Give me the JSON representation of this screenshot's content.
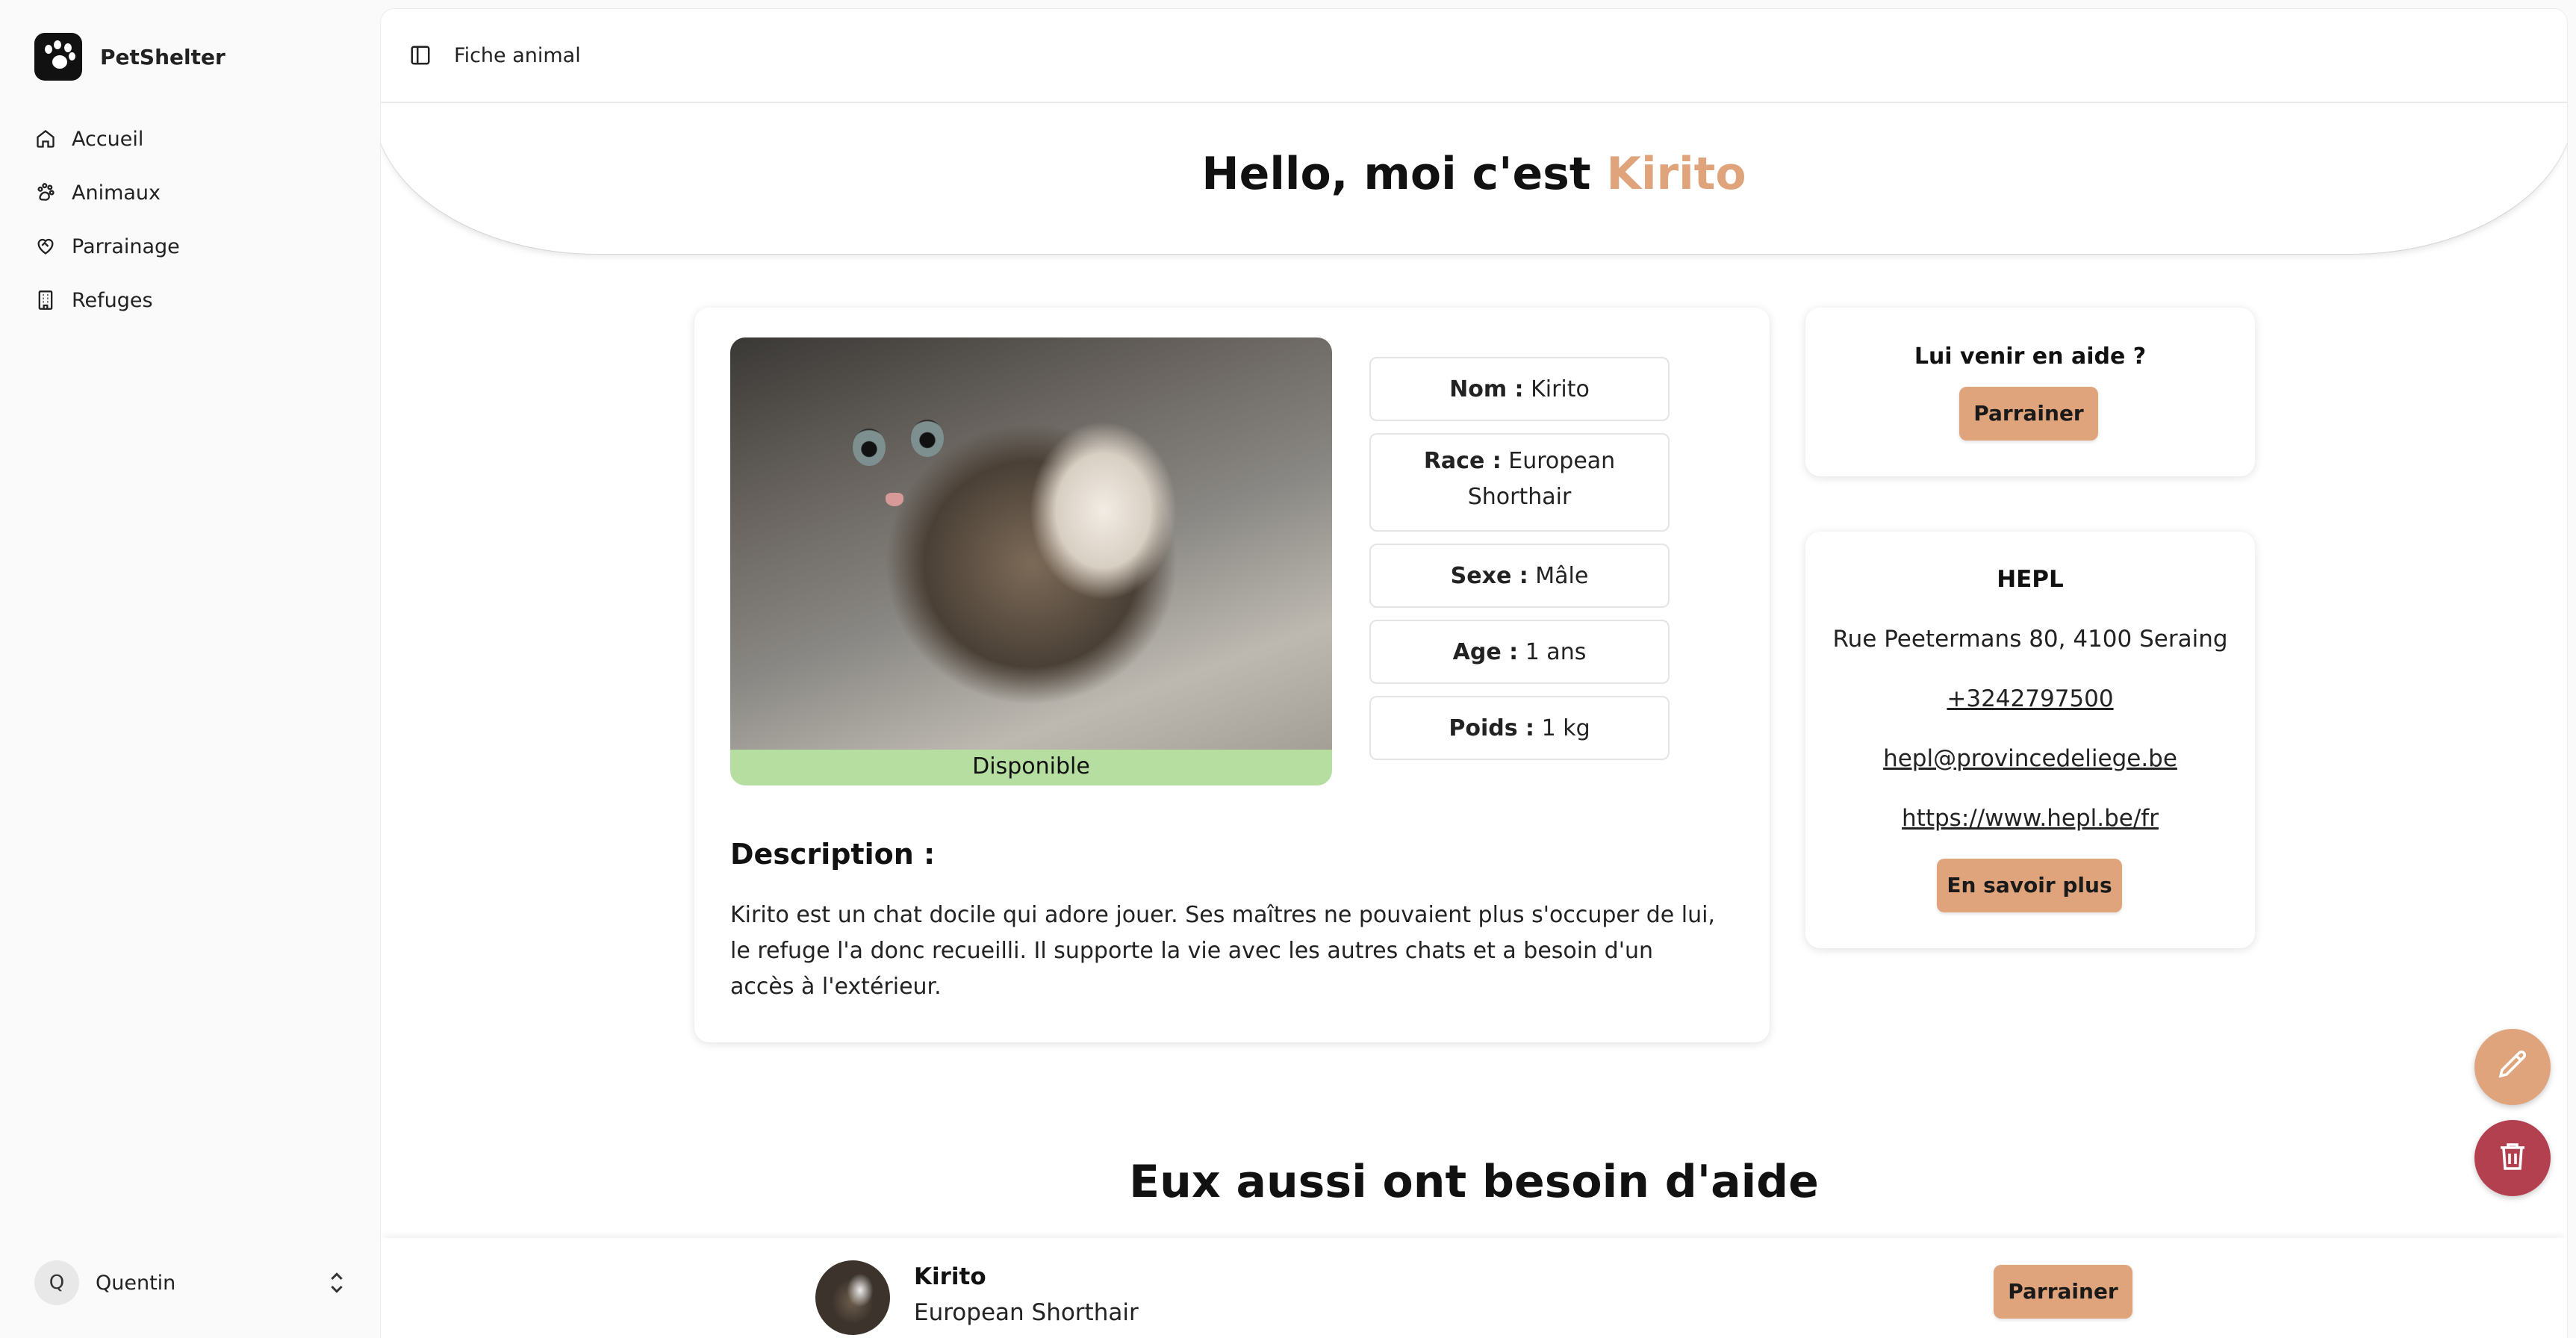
{
  "app": {
    "name": "PetShelter"
  },
  "sidebar": {
    "items": [
      {
        "label": "Accueil",
        "icon": "home-icon"
      },
      {
        "label": "Animaux",
        "icon": "paw-icon"
      },
      {
        "label": "Parrainage",
        "icon": "heart-handshake-icon"
      },
      {
        "label": "Refuges",
        "icon": "building-icon"
      }
    ],
    "user": {
      "initial": "Q",
      "name": "Quentin"
    }
  },
  "header": {
    "breadcrumb": "Fiche animal"
  },
  "hero": {
    "prefix": "Hello, moi c'est ",
    "name": "Kirito"
  },
  "animal": {
    "status": "Disponible",
    "status_color": "#b5dea0",
    "facts": [
      {
        "key": "Nom :",
        "value": "Kirito"
      },
      {
        "key": "Race :",
        "value": "European Shorthair"
      },
      {
        "key": "Sexe :",
        "value": "Mâle"
      },
      {
        "key": "Age :",
        "value": "1 ans"
      },
      {
        "key": "Poids :",
        "value": "1 kg"
      }
    ],
    "description_title": "Description :",
    "description": "Kirito est un chat docile qui adore jouer. Ses maîtres ne pouvaient plus s'occuper de lui, le refuge l'a donc recueilli. Il supporte la vie avec les autres chats et a besoin d'un accès à l'extérieur."
  },
  "help": {
    "title": "Lui venir en aide ?",
    "button": "Parrainer"
  },
  "shelter": {
    "name": "HEPL",
    "address": "Rue Peetermans 80, 4100 Seraing",
    "phone": "+3242797500",
    "email": "hepl@provincedeliege.be",
    "website": "https://www.hepl.be/fr",
    "button": "En savoir plus"
  },
  "actions": {
    "edit_icon": "pencil-icon",
    "delete_icon": "trash-icon"
  },
  "others": {
    "title": "Eux aussi ont besoin d'aide",
    "items": [
      {
        "name": "Kirito",
        "breed": "European Shorthair",
        "button": "Parrainer"
      }
    ]
  },
  "colors": {
    "accent": "#e0a47d",
    "danger": "#b3404f",
    "available": "#b5dea0"
  }
}
